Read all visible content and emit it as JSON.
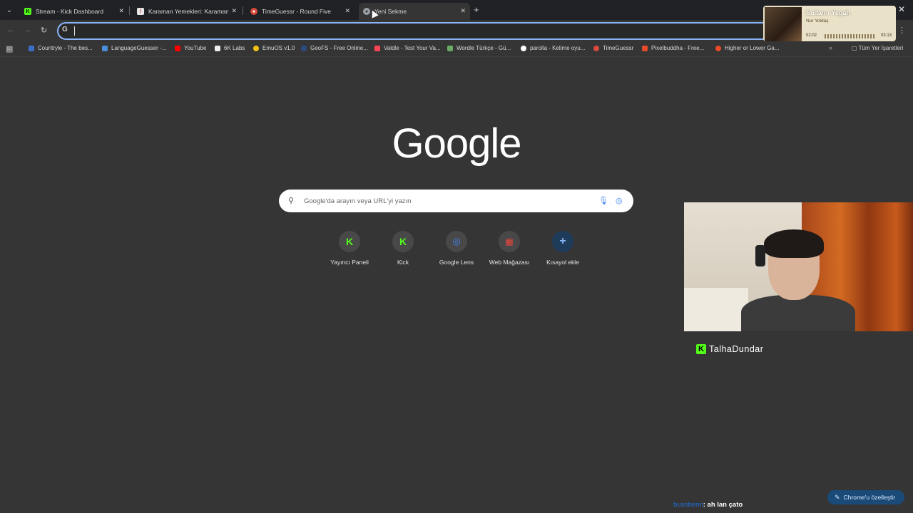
{
  "tabs": [
    {
      "title": "Stream - Kick Dashboard",
      "favicon": "kick-icon",
      "color": "#53fc18"
    },
    {
      "title": "Karaman Yemekleri: Karaman M",
      "favicon": "document-icon",
      "color": "#e8e8e8"
    },
    {
      "title": "TimeGuessr - Round Five",
      "favicon": "timeguessr-icon",
      "color": "#d94a3d"
    },
    {
      "title": "Yeni Sekme",
      "favicon": "chrome-icon",
      "color": "#9aa0a6"
    }
  ],
  "bookmarks": [
    {
      "label": "Countryle - The bes...",
      "color": "#3a6ec8"
    },
    {
      "label": "LanguageGuesser -...",
      "color": "#4a8fd8"
    },
    {
      "label": "YouTube",
      "color": "#ff0000"
    },
    {
      "label": "6K Labs",
      "color": "#f0f0f0"
    },
    {
      "label": "EmuOS v1.0",
      "color": "#f4c20d"
    },
    {
      "label": "GeoFS - Free Online...",
      "color": "#2c4a7a"
    },
    {
      "label": "Valdle - Test Your Va...",
      "color": "#ff4655"
    },
    {
      "label": "Wordle Türkçe - Gü...",
      "color": "#6aaa64"
    },
    {
      "label": "parolla - Kelime oyu...",
      "color": "#ffffff"
    },
    {
      "label": "TimeGuessr",
      "color": "#d94a3d"
    },
    {
      "label": "Pixelbuddha - Free...",
      "color": "#e84a2a"
    },
    {
      "label": "Higher or Lower Ga...",
      "color": "#e84a2a"
    }
  ],
  "bookmarks_all": "Tüm Yer İşaretleri",
  "media": {
    "song": "Sultan-ı Yegah",
    "artist": "Nur Yoldaş",
    "current": "02:02",
    "total": "03:13"
  },
  "google_logo": "Google",
  "search": {
    "placeholder": "Google'da arayın veya URL'yi yazın"
  },
  "shortcuts": [
    {
      "label": "Yayıncı Paneli",
      "glyph": "K",
      "color": "#53fc18"
    },
    {
      "label": "Kick",
      "glyph": "K",
      "color": "#53fc18"
    },
    {
      "label": "Google Lens",
      "glyph": "◎",
      "color": "#4285f4"
    },
    {
      "label": "Web Mağazası",
      "glyph": "▦",
      "color": "#e8453c"
    },
    {
      "label": "Kısayol ekle",
      "glyph": "+",
      "color": "#8ab4f8"
    }
  ],
  "streamer": {
    "name": "TalhaDundar"
  },
  "chat": {
    "user": "busobenn",
    "message": ": ah lan çato"
  },
  "customize_label": "Chrome'u özelleştir"
}
